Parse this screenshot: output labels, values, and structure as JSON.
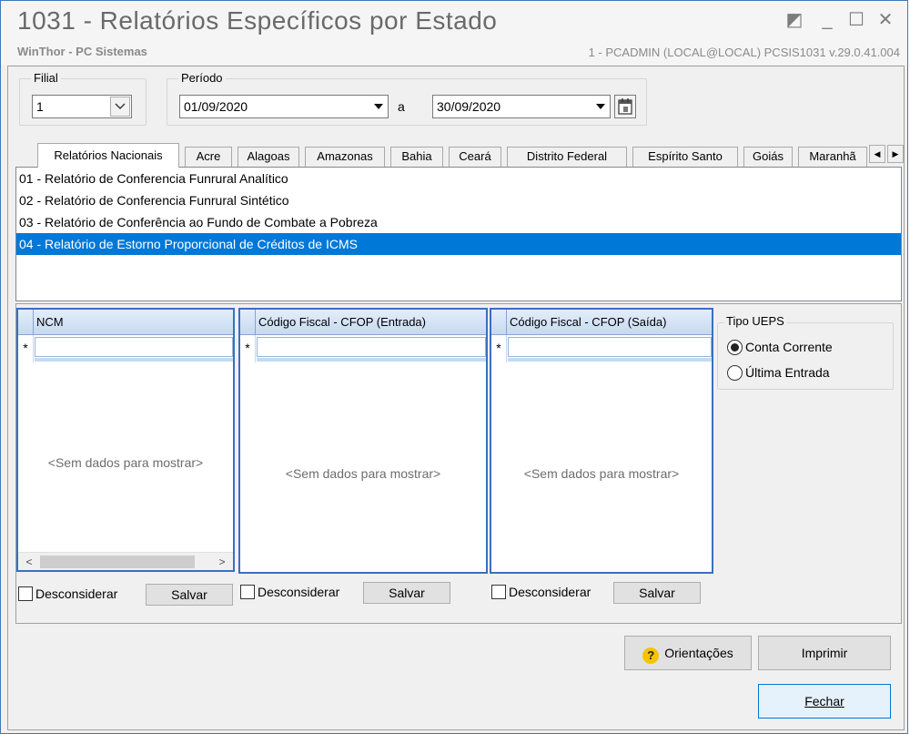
{
  "window": {
    "title": "1031 - Relatórios Específicos por Estado",
    "subtitle": "WinThor - PC Sistemas",
    "info": "1 - PCADMIN (LOCAL@LOCAL)   PCSIS1031  v.29.0.41.004",
    "controls": {
      "restore": "◩",
      "minimize": "_",
      "maximize": "☐",
      "close": "✕"
    }
  },
  "filters": {
    "filial_label": "Filial",
    "filial_value": "1",
    "periodo_label": "Período",
    "date_from": "01/09/2020",
    "between": "a",
    "date_to": "30/09/2020"
  },
  "tabs": [
    {
      "label": "Relatórios Nacionais"
    },
    {
      "label": "Acre"
    },
    {
      "label": "Alagoas"
    },
    {
      "label": "Amazonas"
    },
    {
      "label": "Bahia"
    },
    {
      "label": "Ceará"
    },
    {
      "label": "Distrito Federal"
    },
    {
      "label": "Espírito Santo"
    },
    {
      "label": "Goiás"
    },
    {
      "label": "Maranhã"
    }
  ],
  "tab_scroll": {
    "left": "◀",
    "right": "▶"
  },
  "reports": [
    "01 - Relatório de Conferencia Funrural Analítico",
    "02 - Relatório de Conferencia Funrural Sintético",
    "03 - Relatório de Conferência ao Fundo de Combate a Pobreza",
    "04 - Relatório de Estorno Proporcional de Créditos de ICMS"
  ],
  "grids": {
    "ncm": {
      "header": "NCM",
      "new_row_marker": "*",
      "empty": "<Sem dados para mostrar>"
    },
    "cfop_entrada": {
      "header": "Código Fiscal - CFOP (Entrada)",
      "new_row_marker": "*",
      "empty": "<Sem dados para mostrar>"
    },
    "cfop_saida": {
      "header": "Código Fiscal - CFOP (Saída)",
      "new_row_marker": "*",
      "empty": "<Sem dados para mostrar>"
    }
  },
  "scroll": {
    "left": "<",
    "right": ">"
  },
  "actions": {
    "desconsiderar": "Desconsiderar",
    "salvar": "Salvar"
  },
  "tipo_ueps": {
    "label": "Tipo UEPS",
    "options": [
      "Conta Corrente",
      "Última Entrada"
    ],
    "selected": "Conta Corrente"
  },
  "buttons": {
    "orientacoes": "Orientações",
    "imprimir": "Imprimir",
    "fechar": "Fechar"
  }
}
